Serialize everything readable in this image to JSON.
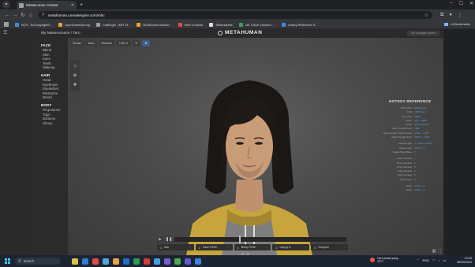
{
  "browser": {
    "tab_title": "MetaHuman Creator",
    "url": "metahuman.unrealengine.com/mhc",
    "bookmarks": [
      {
        "label": "NCS - NoCopyrightS...",
        "color": "#3c8ce7"
      },
      {
        "label": "OpenGameArt.org",
        "color": "#e8a33c"
      },
      {
        "label": "CraftLight - ART of...",
        "color": "#9aa0a6"
      },
      {
        "label": "ModSource Bookm...",
        "color": "#f0a020"
      },
      {
        "label": "Web Controle",
        "color": "#e34a4a"
      },
      {
        "label": "Steamworks",
        "color": "#dddddd"
      },
      {
        "label": "UE: Since Creator L...",
        "color": "#34a853"
      },
      {
        "label": "Library Reference S...",
        "color": "#3c8ce7"
      }
    ],
    "all_bookmarks": "All Bookmarks"
  },
  "app": {
    "breadcrumb": "My MetaHumans / Taro",
    "brand": "METAHUMAN",
    "changes_status": "All changes saved"
  },
  "sidebar": {
    "sections": [
      {
        "title": "FACE",
        "items": [
          "Blend",
          "Skin",
          "Eyes",
          "Teeth",
          "Makeup"
        ]
      },
      {
        "title": "HAIR",
        "items": [
          "Head",
          "Eyebrows",
          "Eyelashes",
          "Mustache",
          "Beard"
        ]
      },
      {
        "title": "BODY",
        "items": [
          "Proportions",
          "Tops",
          "Bottoms",
          "Shoes"
        ]
      }
    ]
  },
  "viewport": {
    "toolbar": [
      "Studio",
      "Auto",
      "Medium",
      "LOD 0",
      "✎",
      "⚙"
    ],
    "tools": [
      "☼",
      "⊕",
      "✥"
    ]
  },
  "hotkeys": {
    "title": "HOTKEY REFERENCE",
    "groups": [
      [
        {
          "k": "Orbit View",
          "v": "RMB Drag"
        },
        {
          "k": "Orbit",
          "v": "LMB Drag"
        },
        {
          "k": "Pan View",
          "v": "MMB"
        },
        {
          "k": "Zoom",
          "v": "ALT + RMB"
        },
        {
          "k": "Zoom",
          "v": "Mouse Wheel"
        },
        {
          "k": "Move Sculpt Point",
          "v": "LMB"
        },
        {
          "k": "Move Sculpt Point Precise",
          "v": "CTRL + LMB"
        },
        {
          "k": "Reset Sculpt Point",
          "v": "SHIFT + LMB"
        }
      ],
      [
        {
          "k": "Rotate Light",
          "v": "L + Mouse Move"
        },
        {
          "k": "Reset Light",
          "v": "SHIFT + L"
        },
        {
          "k": "Toggle Play Mode",
          "v": "T"
        }
      ],
      [
        {
          "k": "Face Camera",
          "v": "1"
        },
        {
          "k": "Body Camera",
          "v": "2"
        },
        {
          "k": "Torso Camera",
          "v": "3"
        },
        {
          "k": "Legs Camera",
          "v": "4"
        },
        {
          "k": "Feet Camera",
          "v": "5"
        },
        {
          "k": "Tilt Camera",
          "v": "6"
        }
      ],
      [
        {
          "k": "Undo",
          "v": "CTRL + Z"
        },
        {
          "k": "Redo",
          "v": "CTRL + Y"
        }
      ]
    ]
  },
  "playback": {
    "presets": [
      {
        "icon": "☺",
        "label": "Idle"
      },
      {
        "icon": "☺",
        "label": "Face ROM"
      },
      {
        "icon": "☺",
        "label": "Body ROM"
      },
      {
        "icon": "☺",
        "label": "Happy A"
      },
      {
        "icon": "☺",
        "label": "Surprise"
      }
    ]
  },
  "taskbar": {
    "search_label": "Search",
    "apps": [
      "#e0c24a",
      "#2f7bd8",
      "#e34a4a",
      "#4fa3e0",
      "#e8a33c",
      "#1f6fd0",
      "#2a9d54",
      "#d83b3b",
      "#3ea0e0",
      "#7a5cd6",
      "#48b04a",
      "#5c5cd6",
      "#3a86e0"
    ],
    "weather_line1": "Hari panas yang...",
    "weather_line2": "30°C",
    "tray_lang": "ENG",
    "time": "13:03",
    "date": "08/09/2024"
  }
}
